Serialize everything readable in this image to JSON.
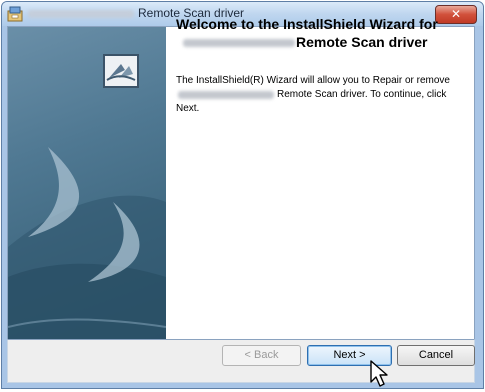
{
  "window": {
    "title_suffix": "Remote Scan driver",
    "close_label": "✕"
  },
  "welcome": {
    "title_line1": "Welcome to the InstallShield Wizard for",
    "title_line2": "Remote Scan driver"
  },
  "description": {
    "line1": "The InstallShield(R) Wizard will allow you to Repair or remove",
    "line2": "Remote Scan driver. To continue, click",
    "line3": "Next."
  },
  "buttons": {
    "back": "< Back",
    "next": "Next >",
    "cancel": "Cancel"
  },
  "icons": {
    "app": "installer-icon",
    "logo": "installshield-logo-icon",
    "cursor": "mouse-pointer-icon"
  }
}
